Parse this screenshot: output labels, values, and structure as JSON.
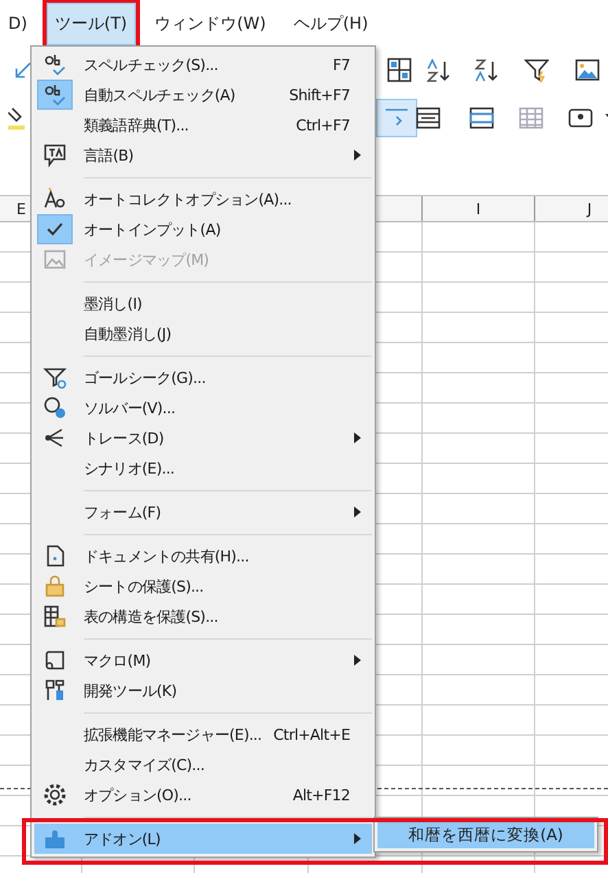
{
  "menubar": [
    {
      "label": "D)",
      "selected": false
    },
    {
      "label": "ツール(T)",
      "selected": true
    },
    {
      "label": "ウィンドウ(W)",
      "selected": false
    },
    {
      "label": "ヘルプ(H)",
      "selected": false
    }
  ],
  "column_headers": [
    "E",
    "I",
    "J"
  ],
  "menu": {
    "items": [
      {
        "kind": "item",
        "label": "スペルチェック(S)...",
        "shortcut": "F7",
        "checked": false,
        "disabled": false,
        "has_submenu": false,
        "selected": false
      },
      {
        "kind": "item",
        "label": "自動スペルチェック(A)",
        "shortcut": "Shift+F7",
        "checked": true,
        "disabled": false,
        "has_submenu": false,
        "selected": false
      },
      {
        "kind": "item",
        "label": "類義語辞典(T)...",
        "shortcut": "Ctrl+F7",
        "checked": false,
        "disabled": false,
        "has_submenu": false,
        "selected": false
      },
      {
        "kind": "item",
        "label": "言語(B)",
        "checked": false,
        "disabled": false,
        "has_submenu": true,
        "selected": false
      },
      {
        "kind": "separator"
      },
      {
        "kind": "item",
        "label": "オートコレクトオプション(A)...",
        "checked": false,
        "disabled": false,
        "has_submenu": false,
        "selected": false
      },
      {
        "kind": "item",
        "label": "オートインプット(A)",
        "checked": true,
        "disabled": false,
        "has_submenu": false,
        "selected": false
      },
      {
        "kind": "item",
        "label": "イメージマップ(M)",
        "checked": false,
        "disabled": true,
        "has_submenu": false,
        "selected": false
      },
      {
        "kind": "separator"
      },
      {
        "kind": "item",
        "label": "墨消し(I)",
        "checked": false,
        "disabled": false,
        "has_submenu": false,
        "selected": false
      },
      {
        "kind": "item",
        "label": "自動墨消し(J)",
        "checked": false,
        "disabled": false,
        "has_submenu": false,
        "selected": false
      },
      {
        "kind": "separator"
      },
      {
        "kind": "item",
        "label": "ゴールシーク(G)...",
        "checked": false,
        "disabled": false,
        "has_submenu": false,
        "selected": false
      },
      {
        "kind": "item",
        "label": "ソルバー(V)...",
        "checked": false,
        "disabled": false,
        "has_submenu": false,
        "selected": false
      },
      {
        "kind": "item",
        "label": "トレース(D)",
        "checked": false,
        "disabled": false,
        "has_submenu": true,
        "selected": false
      },
      {
        "kind": "item",
        "label": "シナリオ(E)...",
        "checked": false,
        "disabled": false,
        "has_submenu": false,
        "selected": false
      },
      {
        "kind": "separator"
      },
      {
        "kind": "item",
        "label": "フォーム(F)",
        "checked": false,
        "disabled": false,
        "has_submenu": true,
        "selected": false
      },
      {
        "kind": "separator"
      },
      {
        "kind": "item",
        "label": "ドキュメントの共有(H)...",
        "checked": false,
        "disabled": false,
        "has_submenu": false,
        "selected": false
      },
      {
        "kind": "item",
        "label": "シートの保護(S)...",
        "checked": false,
        "disabled": false,
        "has_submenu": false,
        "selected": false
      },
      {
        "kind": "item",
        "label": "表の構造を保護(S)...",
        "checked": false,
        "disabled": false,
        "has_submenu": false,
        "selected": false
      },
      {
        "kind": "separator"
      },
      {
        "kind": "item",
        "label": "マクロ(M)",
        "checked": false,
        "disabled": false,
        "has_submenu": true,
        "selected": false
      },
      {
        "kind": "item",
        "label": "開発ツール(K)",
        "checked": false,
        "disabled": false,
        "has_submenu": false,
        "selected": false
      },
      {
        "kind": "separator"
      },
      {
        "kind": "item",
        "label": "拡張機能マネージャー(E)...",
        "shortcut": "Ctrl+Alt+E",
        "checked": false,
        "disabled": false,
        "has_submenu": false,
        "selected": false
      },
      {
        "kind": "item",
        "label": "カスタマイズ(C)...",
        "checked": false,
        "disabled": false,
        "has_submenu": false,
        "selected": false
      },
      {
        "kind": "item",
        "label": "オプション(O)...",
        "shortcut": "Alt+F12",
        "checked": false,
        "disabled": false,
        "has_submenu": false,
        "selected": false
      },
      {
        "kind": "separator"
      },
      {
        "kind": "item",
        "label": "アドオン(L)",
        "checked": false,
        "disabled": false,
        "has_submenu": true,
        "selected": true
      }
    ]
  },
  "submenu": {
    "items": [
      {
        "label": "和暦を西暦に変換(A)",
        "selected": true
      }
    ]
  }
}
